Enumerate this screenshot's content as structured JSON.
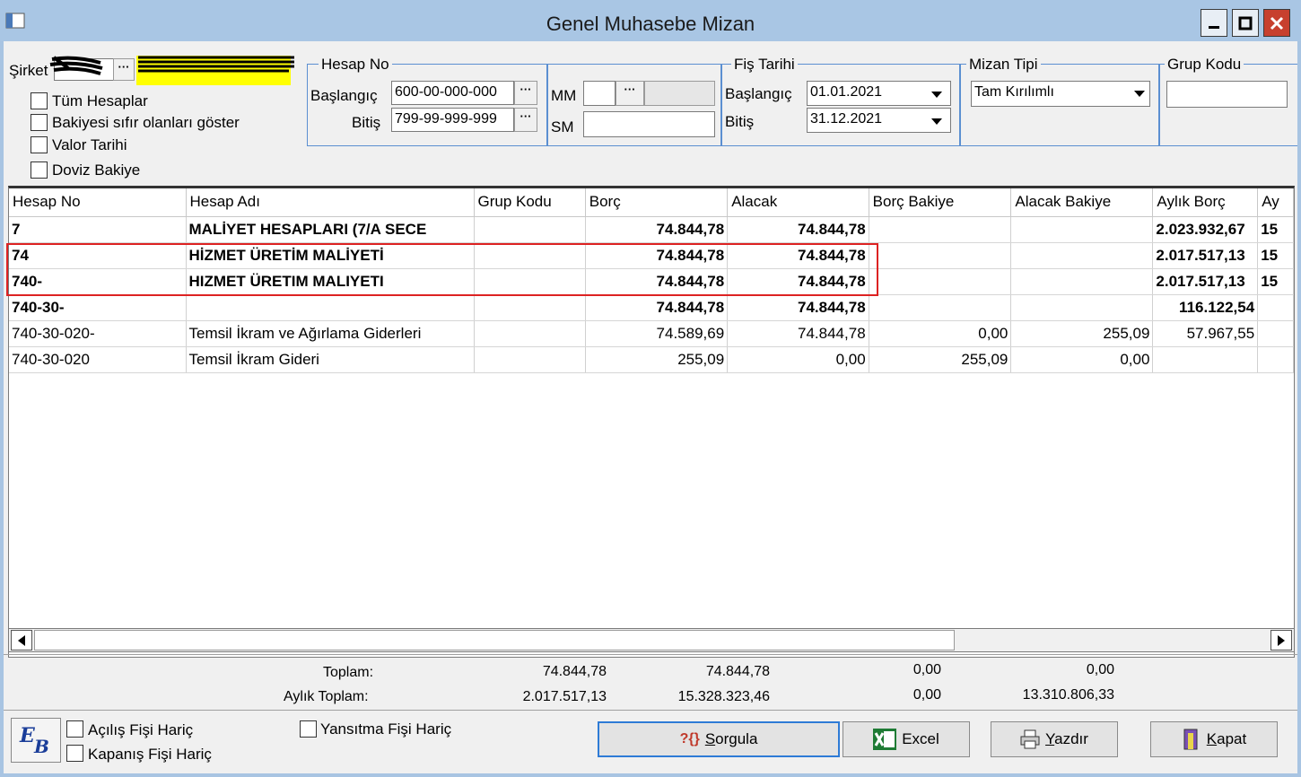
{
  "window": {
    "title": "Genel Muhasebe Mizan",
    "controls": {
      "minimize": "▬",
      "maximize": "◘",
      "close": "✕"
    }
  },
  "filters": {
    "sirket_label": "Şirket",
    "sirket_ellipsis": "···",
    "tum_hesaplar": "Tüm Hesaplar",
    "bakiyesi_sifir": "Bakiyesi sıfır olanları göster",
    "valor_tarihi": "Valor Tarihi",
    "doviz_bakiye": "Doviz Bakiye"
  },
  "hesap_no": {
    "title": "Hesap No",
    "baslangic_label": "Başlangıç",
    "baslangic_value": "600-00-000-000",
    "bitis_label": "Bitiş",
    "bitis_value": "799-99-999-999",
    "ellipsis": "···"
  },
  "mm_sm": {
    "mm_label": "MM",
    "sm_label": "SM",
    "mm_value": "",
    "sm_value": "",
    "ellipsis": "···"
  },
  "fis_tarihi": {
    "title": "Fiş Tarihi",
    "baslangic_label": "Başlangıç",
    "baslangic_value": "01.01.2021",
    "bitis_label": "Bitiş",
    "bitis_value": "31.12.2021"
  },
  "mizan_tipi": {
    "title": "Mizan Tipi",
    "value": "Tam Kırılımlı"
  },
  "grup_kodu": {
    "title": "Grup Kodu",
    "value": ""
  },
  "grid": {
    "headers": [
      "Hesap No",
      "Hesap Adı",
      "Grup Kodu",
      "Borç",
      "Alacak",
      "Borç Bakiye",
      "Alacak Bakiye",
      "Aylık Borç",
      "Ay"
    ],
    "rows": [
      {
        "bold": true,
        "cells": [
          "7",
          "MALİYET HESAPLARI (7/A SECE",
          "",
          "74.844,78",
          "74.844,78",
          "",
          "",
          "2.023.932,67",
          "15"
        ]
      },
      {
        "bold": true,
        "cells": [
          "74",
          "HİZMET ÜRETİM MALİYETİ",
          "",
          "74.844,78",
          "74.844,78",
          "",
          "",
          "2.017.517,13",
          "15"
        ]
      },
      {
        "bold": true,
        "cells": [
          "740-",
          "HIZMET ÜRETIM MALIYETI",
          "",
          "74.844,78",
          "74.844,78",
          "",
          "",
          "2.017.517,13",
          "15"
        ]
      },
      {
        "bold": true,
        "cells": [
          "740-30-",
          "",
          "",
          "74.844,78",
          "74.844,78",
          "",
          "",
          "116.122,54",
          ""
        ]
      },
      {
        "bold": false,
        "cells": [
          "740-30-020-",
          "Temsil İkram ve Ağırlama Giderleri",
          "",
          "74.589,69",
          "74.844,78",
          "0,00",
          "255,09",
          "57.967,55",
          ""
        ]
      },
      {
        "bold": false,
        "cells": [
          "740-30-020",
          "Temsil İkram Gideri",
          "",
          "255,09",
          "0,00",
          "255,09",
          "0,00",
          "",
          ""
        ]
      }
    ]
  },
  "totals": {
    "toplam_label": "Toplam:",
    "aylik_label": "Aylık Toplam:",
    "toplam": [
      "74.844,78",
      "74.844,78",
      "0,00",
      "0,00"
    ],
    "aylik": [
      "2.017.517,13",
      "15.328.323,46",
      "0,00",
      "13.310.806,33"
    ]
  },
  "footer": {
    "logo": "EB",
    "acilis": "Açılış Fişi Hariç",
    "kapanis": "Kapanış Fişi Hariç",
    "yansitma": "Yansıtma Fişi Hariç",
    "sorgula_icon": "?{}",
    "sorgula_prefix": "S",
    "sorgula_rest": "orgula",
    "excel": "Excel",
    "yazdir_prefix": "Y",
    "yazdir_rest": "azdır",
    "kapat_prefix": "K",
    "kapat_rest": "apat"
  },
  "colors": {
    "title_bg": "#a9c6e4",
    "highlight": "#ffff00",
    "group_border": "#5b8fd1",
    "selection_box": "#dd2222"
  }
}
